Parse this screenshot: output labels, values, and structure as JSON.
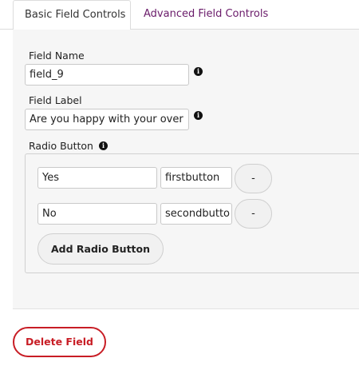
{
  "tabs": {
    "basic": "Basic Field Controls",
    "advanced": "Advanced Field Controls"
  },
  "field_name": {
    "label": "Field Name",
    "value": "field_9",
    "info_icon": "info-icon"
  },
  "field_label": {
    "label": "Field Label",
    "value": "Are you happy with your over",
    "info_icon": "info-icon"
  },
  "radio_button": {
    "label": "Radio Button",
    "options": [
      {
        "text": "Yes",
        "value": "firstbutton",
        "remove_label": "-"
      },
      {
        "text": "No",
        "value": "secondbutto",
        "remove_label": "-"
      }
    ],
    "add_label": "Add Radio Button"
  },
  "actions": {
    "delete_label": "Delete Field"
  },
  "colors": {
    "accent_purple": "#6a1b6a",
    "danger_red": "#c81d25",
    "panel_bg": "#f6f6f6"
  }
}
